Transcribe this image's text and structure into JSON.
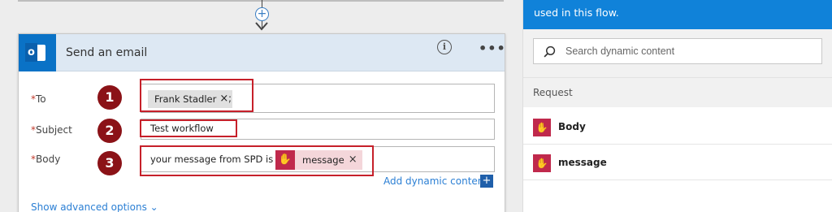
{
  "card": {
    "title": "Send an email",
    "info_glyph": "i",
    "more_glyph": "•••"
  },
  "fields": {
    "to": {
      "label": "To",
      "token": "Frank Stadler",
      "separator": ";"
    },
    "subject": {
      "label": "Subject",
      "value": "Test workflow"
    },
    "body": {
      "label": "Body",
      "text": "your message from SPD is -",
      "token": "message"
    }
  },
  "callouts": [
    "1",
    "2",
    "3"
  ],
  "links": {
    "add_dynamic": "Add dynamic content",
    "show_advanced": "Show advanced options"
  },
  "pane": {
    "banner": "used in this flow.",
    "search_placeholder": "Search dynamic content",
    "section": "Request",
    "items": [
      {
        "name": "Body"
      },
      {
        "name": "message"
      }
    ]
  },
  "colors": {
    "accent": "#1082d9",
    "token": "#c0294c",
    "callout": "#c6202a",
    "badge": "#8b1217"
  },
  "icons": {
    "add": "plus-circle-icon",
    "remove": "x-icon",
    "search": "search-icon",
    "dynamic_token": "request-trigger-icon"
  }
}
